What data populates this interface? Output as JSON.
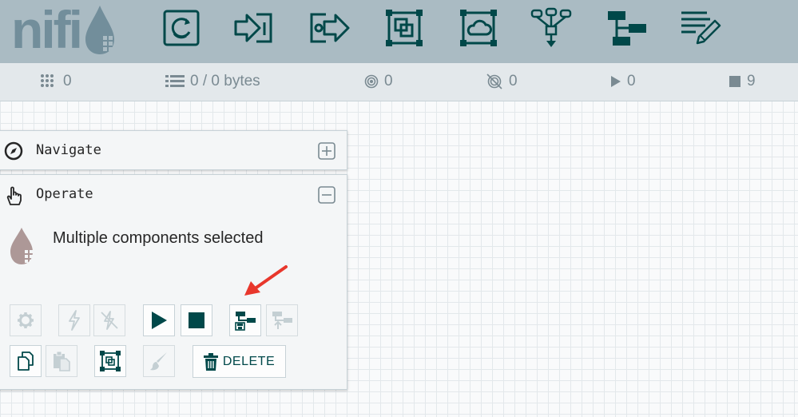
{
  "header": {
    "logo_text": "nifi",
    "colors": {
      "header_bg": "#aabbc3",
      "icon": "#004849",
      "logo": "#728e9b"
    },
    "toolbar": [
      {
        "name": "processor-icon"
      },
      {
        "name": "input-port-icon"
      },
      {
        "name": "output-port-icon"
      },
      {
        "name": "process-group-icon"
      },
      {
        "name": "remote-process-group-icon"
      },
      {
        "name": "funnel-icon"
      },
      {
        "name": "template-icon"
      },
      {
        "name": "label-icon"
      }
    ]
  },
  "status": {
    "active_threads": "0",
    "queued": "0 / 0 bytes",
    "transmitting": "0",
    "not_transmitting": "0",
    "running": "0",
    "stopped": "9"
  },
  "navigate": {
    "title": "Navigate",
    "icon": "compass-icon",
    "toggle_icon": "plus-square-icon"
  },
  "operate": {
    "title": "Operate",
    "icon": "hand-pointer-icon",
    "toggle_icon": "minus-square-icon",
    "selection_text": "Multiple components selected",
    "delete_label": "DELETE",
    "buttons": [
      {
        "name": "configure-icon",
        "enabled": false
      },
      {
        "name": "enable-icon",
        "enabled": false
      },
      {
        "name": "disable-icon",
        "enabled": false
      },
      {
        "name": "start-icon",
        "enabled": true
      },
      {
        "name": "stop-icon",
        "enabled": true
      },
      {
        "name": "create-template-icon",
        "enabled": true
      },
      {
        "name": "upload-template-icon",
        "enabled": false
      },
      {
        "name": "copy-icon",
        "enabled": true
      },
      {
        "name": "paste-icon",
        "enabled": false
      },
      {
        "name": "group-icon",
        "enabled": true
      },
      {
        "name": "color-icon",
        "enabled": false
      },
      {
        "name": "trash-icon",
        "enabled": true
      }
    ],
    "colors": {
      "enabled": "#004849",
      "disabled": "#c4cfd3",
      "arrow": "#e8372c"
    }
  }
}
